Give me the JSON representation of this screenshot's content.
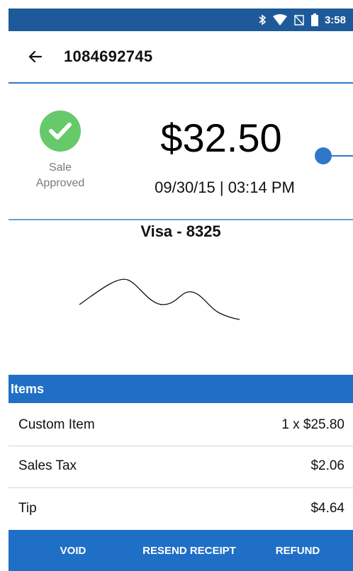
{
  "status_bar": {
    "time": "3:58",
    "icons": [
      "bluetooth-icon",
      "wifi-icon",
      "no-sim-icon",
      "battery-icon"
    ]
  },
  "app_bar": {
    "title": "1084692745",
    "back_icon": "arrow-left-icon"
  },
  "transaction": {
    "amount": "$32.50",
    "datetime": "09/30/15  |  03:14 PM",
    "status_line1": "Sale",
    "status_line2": "Approved",
    "card": "Visa - 8325"
  },
  "items": {
    "header": "Items",
    "rows": [
      {
        "name": "Custom Item",
        "value": "1 x $25.80"
      },
      {
        "name": "Sales Tax",
        "value": "$2.06"
      },
      {
        "name": "Tip",
        "value": "$4.64"
      }
    ]
  },
  "actions": {
    "void": "VOID",
    "resend": "RESEND RECEIPT",
    "refund": "REFUND"
  },
  "colors": {
    "primary": "#1f6fc6",
    "status_bar": "#1e5a9a",
    "success": "#66c96a"
  }
}
